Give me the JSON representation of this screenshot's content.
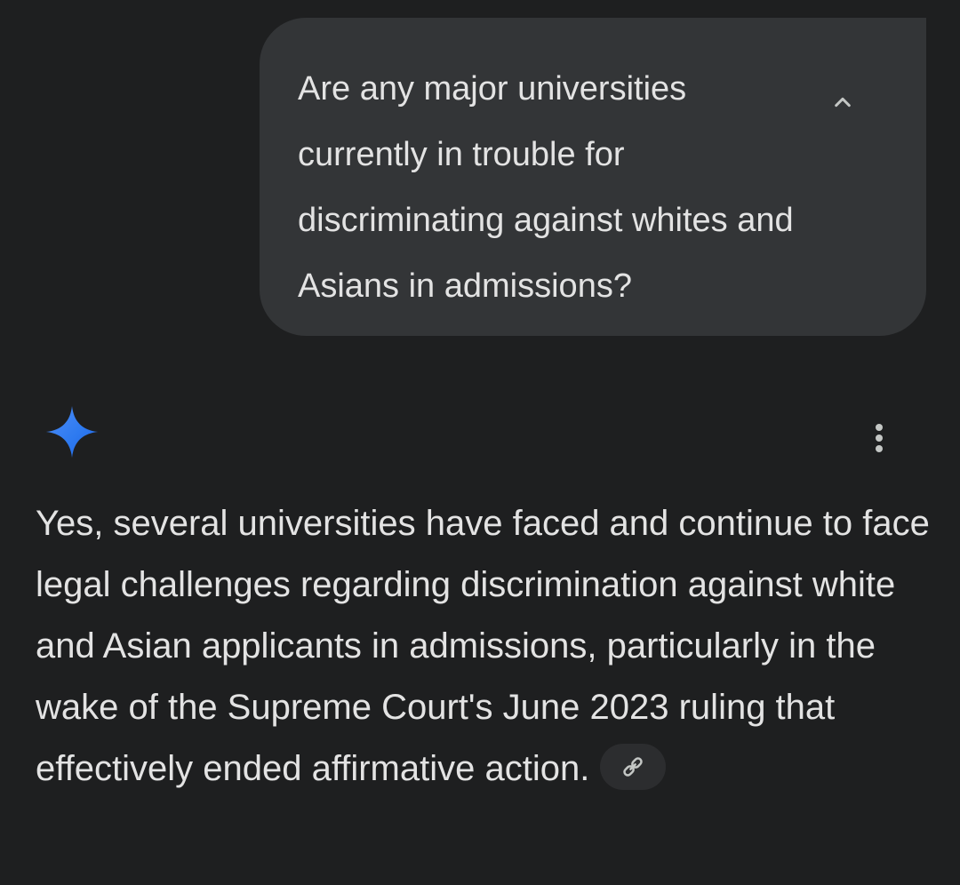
{
  "user_message": {
    "text": "Are any major universities currently in trouble for discriminating against whites and Asians in admissions?"
  },
  "response": {
    "text": "Yes, several universities have faced and continue to face legal challenges regarding discrimination against white and Asian applicants in admissions, particularly in the wake of the Supreme Court's June 2023 ruling that effectively ended affirmative action."
  },
  "icons": {
    "collapse": "chevron-up-icon",
    "assistant": "gemini-sparkle-icon",
    "more": "more-vert-icon",
    "source": "link-icon"
  },
  "colors": {
    "background": "#1e1f20",
    "bubble": "#333537",
    "text": "#e3e3e3",
    "accent": "#4285f4"
  }
}
